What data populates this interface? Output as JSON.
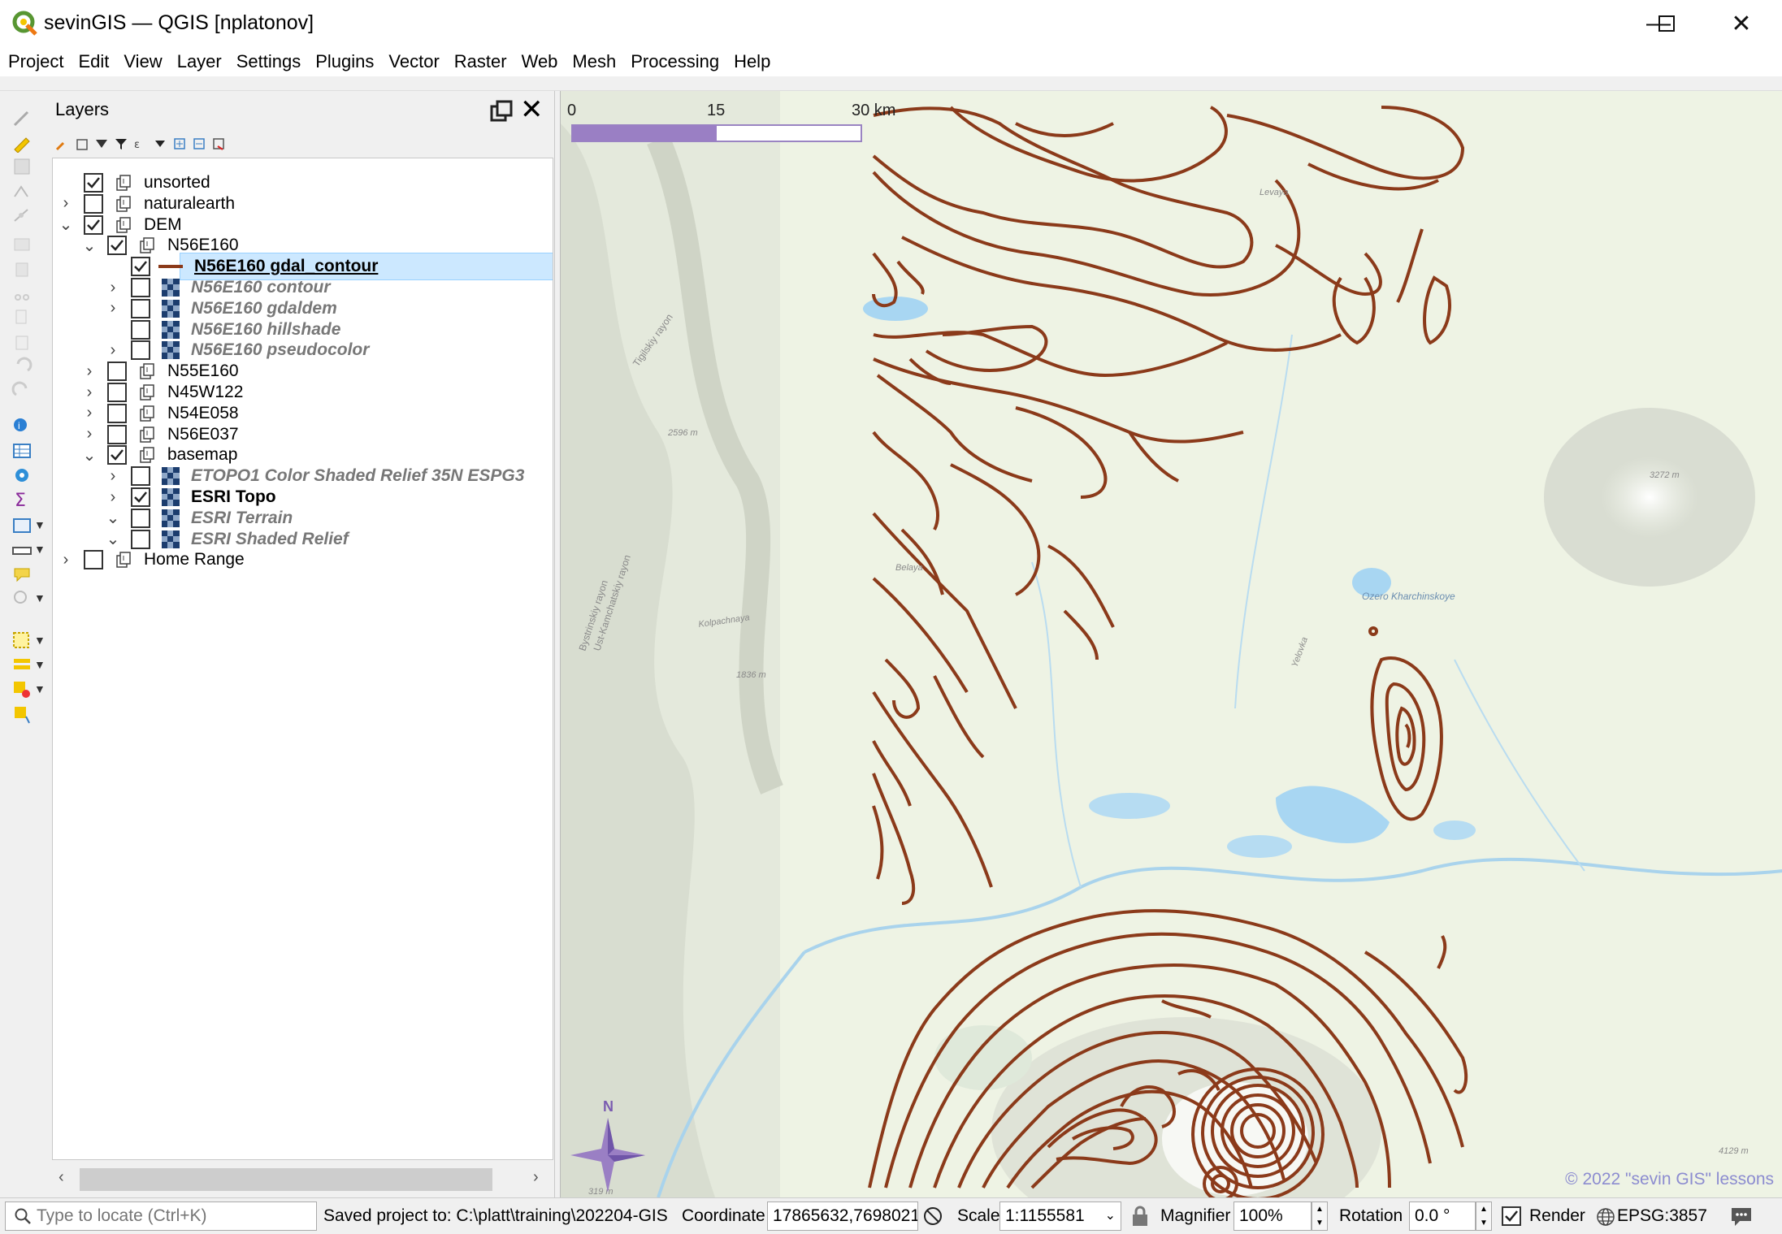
{
  "window": {
    "title": "sevinGIS — QGIS [nplatonov]",
    "minimize_glyph": "—",
    "maximize_glyph": "☐",
    "close_glyph": "✕"
  },
  "menu": [
    "Project",
    "Edit",
    "View",
    "Layer",
    "Settings",
    "Plugins",
    "Vector",
    "Raster",
    "Web",
    "Mesh",
    "Processing",
    "Help"
  ],
  "layers_panel": {
    "title": "Layers",
    "tree": [
      {
        "label": "unsorted",
        "checked": true,
        "expander": "",
        "indent": 0,
        "kind": "group",
        "style": "normal"
      },
      {
        "label": "naturalearth",
        "checked": false,
        "expander": "›",
        "indent": 0,
        "kind": "group",
        "style": "normal"
      },
      {
        "label": "DEM",
        "checked": true,
        "expander": "⌄",
        "indent": 0,
        "kind": "group",
        "style": "normal"
      },
      {
        "label": "N56E160",
        "checked": true,
        "expander": "⌄",
        "indent": 1,
        "kind": "group",
        "style": "normal"
      },
      {
        "label": "N56E160 gdal_contour",
        "checked": true,
        "expander": "",
        "indent": 2,
        "kind": "line",
        "style": "selected"
      },
      {
        "label": "N56E160 contour",
        "checked": false,
        "expander": "›",
        "indent": 2,
        "kind": "raster",
        "style": "italic"
      },
      {
        "label": "N56E160 gdaldem",
        "checked": false,
        "expander": "›",
        "indent": 2,
        "kind": "raster",
        "style": "italic"
      },
      {
        "label": "N56E160 hillshade",
        "checked": false,
        "expander": "",
        "indent": 2,
        "kind": "raster",
        "style": "italic"
      },
      {
        "label": "N56E160 pseudocolor",
        "checked": false,
        "expander": "›",
        "indent": 2,
        "kind": "raster",
        "style": "italic"
      },
      {
        "label": "N55E160",
        "checked": false,
        "expander": "›",
        "indent": 1,
        "kind": "group",
        "style": "normal"
      },
      {
        "label": "N45W122",
        "checked": false,
        "expander": "›",
        "indent": 1,
        "kind": "group",
        "style": "normal"
      },
      {
        "label": "N54E058",
        "checked": false,
        "expander": "›",
        "indent": 1,
        "kind": "group",
        "style": "normal"
      },
      {
        "label": "N56E037",
        "checked": false,
        "expander": "›",
        "indent": 1,
        "kind": "group",
        "style": "normal"
      },
      {
        "label": "basemap",
        "checked": true,
        "expander": "⌄",
        "indent": 1,
        "kind": "group",
        "style": "normal"
      },
      {
        "label": "ETOPO1 Color Shaded Relief 35N ESPG3",
        "checked": false,
        "expander": "›",
        "indent": 2,
        "kind": "raster",
        "style": "italic"
      },
      {
        "label": "ESRI Topo",
        "checked": true,
        "expander": "›",
        "indent": 2,
        "kind": "raster",
        "style": "bold"
      },
      {
        "label": "ESRI Terrain",
        "checked": false,
        "expander": "⌄",
        "indent": 2,
        "kind": "raster",
        "style": "italic"
      },
      {
        "label": "ESRI Shaded Relief",
        "checked": false,
        "expander": "⌄",
        "indent": 2,
        "kind": "raster",
        "style": "italic"
      },
      {
        "label": "Home Range",
        "checked": false,
        "expander": "›",
        "indent": 0,
        "kind": "group",
        "style": "normal"
      }
    ]
  },
  "map": {
    "scale_bar": {
      "ticks": [
        "0",
        "15",
        "30 km"
      ]
    },
    "north_label": "N",
    "labels": {
      "tigilskiy": "Tigilskiy rayon",
      "elev_2596": "2596 m",
      "belaya": "Belaya",
      "bystrinskiy": "Bystrinskiy rayon",
      "ust_kamchatskiy": "Ust-Kamchatskiy rayon",
      "kolpachnaya": "Kolpachnaya",
      "elev_1836": "1836 m",
      "levaya": "Levaya",
      "lake": "Ozero Kharchinskoye",
      "yelovka": "Yelovka",
      "elev_3272": "3272 m",
      "elev_4129": "4129 m",
      "elev_319": "319 m"
    },
    "copyright": "© 2022 \"sevin GIS\" lessons",
    "contour_color": "#8b3a1a"
  },
  "statusbar": {
    "locator_placeholder": "Type to locate (Ctrl+K)",
    "message": "Saved project to: C:\\platt\\training\\202204-GIS",
    "coordinate_label": "Coordinate",
    "coordinate_value": "17865632,7698021",
    "scale_label": "Scale",
    "scale_value": "1:1155581",
    "magnifier_label": "Magnifier",
    "magnifier_value": "100%",
    "rotation_label": "Rotation",
    "rotation_value": "0.0 °",
    "render_label": "Render",
    "render_checked": true,
    "crs": "EPSG:3857"
  }
}
